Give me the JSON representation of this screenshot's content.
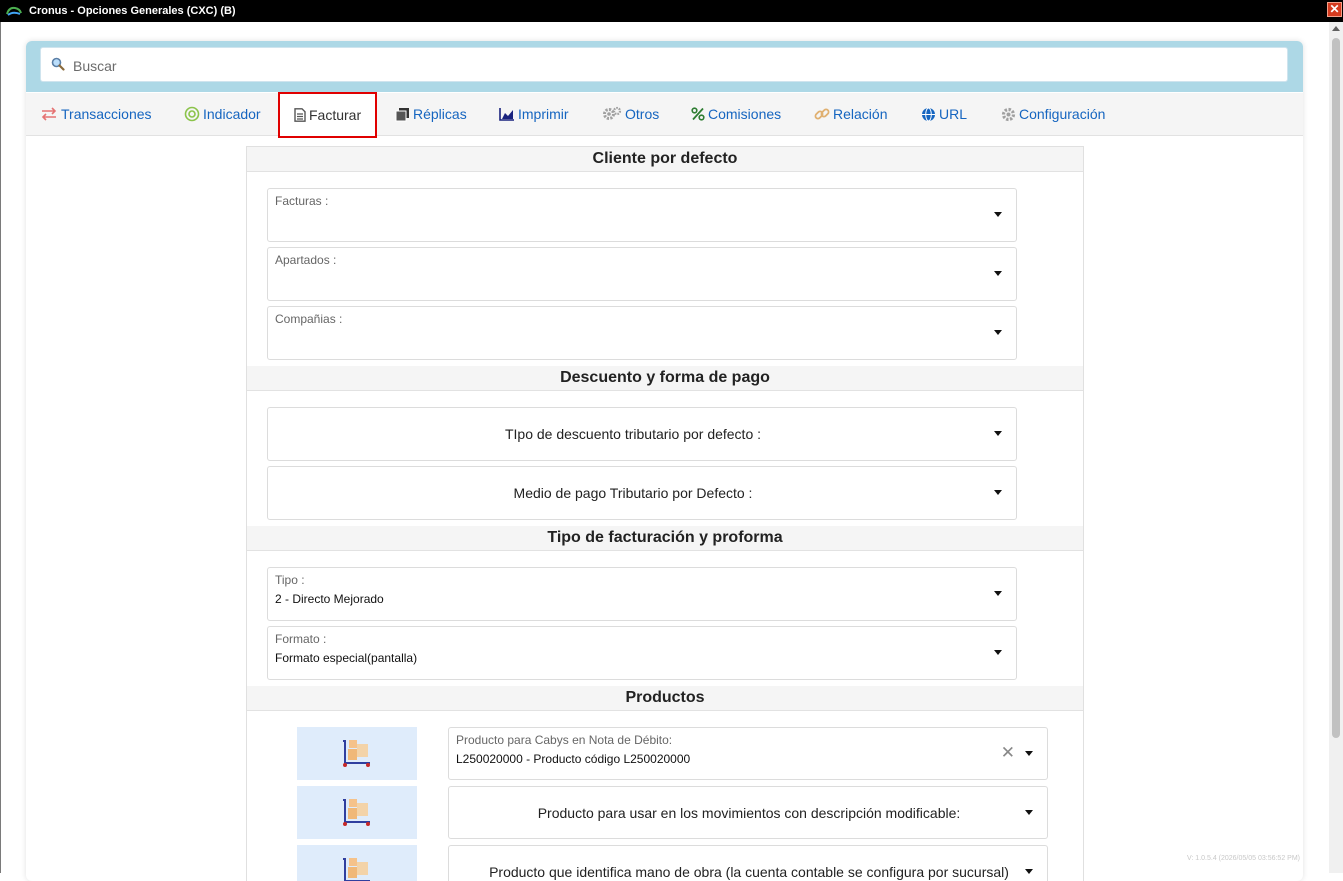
{
  "window": {
    "title": "Cronus - Opciones Generales (CXC) (B)"
  },
  "search": {
    "placeholder": "Buscar"
  },
  "tabs": [
    {
      "label": "Transacciones",
      "icon": "arrows-exchange-icon",
      "color": "#e53935"
    },
    {
      "label": "Indicador",
      "icon": "target-icon",
      "color": "#8bc34a"
    },
    {
      "label": "Facturar",
      "icon": "document-icon",
      "color": "#555555",
      "active": true
    },
    {
      "label": "Réplicas",
      "icon": "copy-icon",
      "color": "#333333"
    },
    {
      "label": "Imprimir",
      "icon": "area-chart-icon",
      "color": "#1a237e"
    },
    {
      "label": "Otros",
      "icon": "gears-icon",
      "color": "#9e9e9e"
    },
    {
      "label": "Comisiones",
      "icon": "percent-icon",
      "color": "#2e7d32"
    },
    {
      "label": "Relación",
      "icon": "link-icon",
      "color": "#e0b070"
    },
    {
      "label": "URL",
      "icon": "globe-icon",
      "color": "#1565c0"
    },
    {
      "label": "Configuración",
      "icon": "gear-icon",
      "color": "#9e9e9e"
    }
  ],
  "sections": {
    "cliente": {
      "title": "Cliente por defecto",
      "fields": [
        {
          "label": "Facturas :",
          "value": ""
        },
        {
          "label": "Apartados :",
          "value": ""
        },
        {
          "label": "Compañias :",
          "value": ""
        }
      ]
    },
    "descuento": {
      "title": "Descuento y forma de pago",
      "fields": [
        {
          "label": "TIpo de descuento tributario por defecto :"
        },
        {
          "label": "Medio de pago Tributario por Defecto :"
        }
      ]
    },
    "tipo_facturacion": {
      "title": "Tipo de facturación y proforma",
      "fields": [
        {
          "label": "Tipo :",
          "value": "2 - Directo Mejorado"
        },
        {
          "label": "Formato :",
          "value": "Formato especial(pantalla)"
        }
      ]
    },
    "productos": {
      "title": "Productos",
      "items": [
        {
          "label": "Producto para Cabys en Nota de Débito:",
          "value": "L250020000 - Producto código L250020000"
        },
        {
          "label": "Producto para usar en los movimientos con descripción modificable:"
        },
        {
          "label": "Producto que identifica mano de obra (la cuenta contable se configura por sucursal)"
        }
      ]
    }
  },
  "version": "V: 1.0.5.4 (2026/05/05 03:56:52 PM)"
}
